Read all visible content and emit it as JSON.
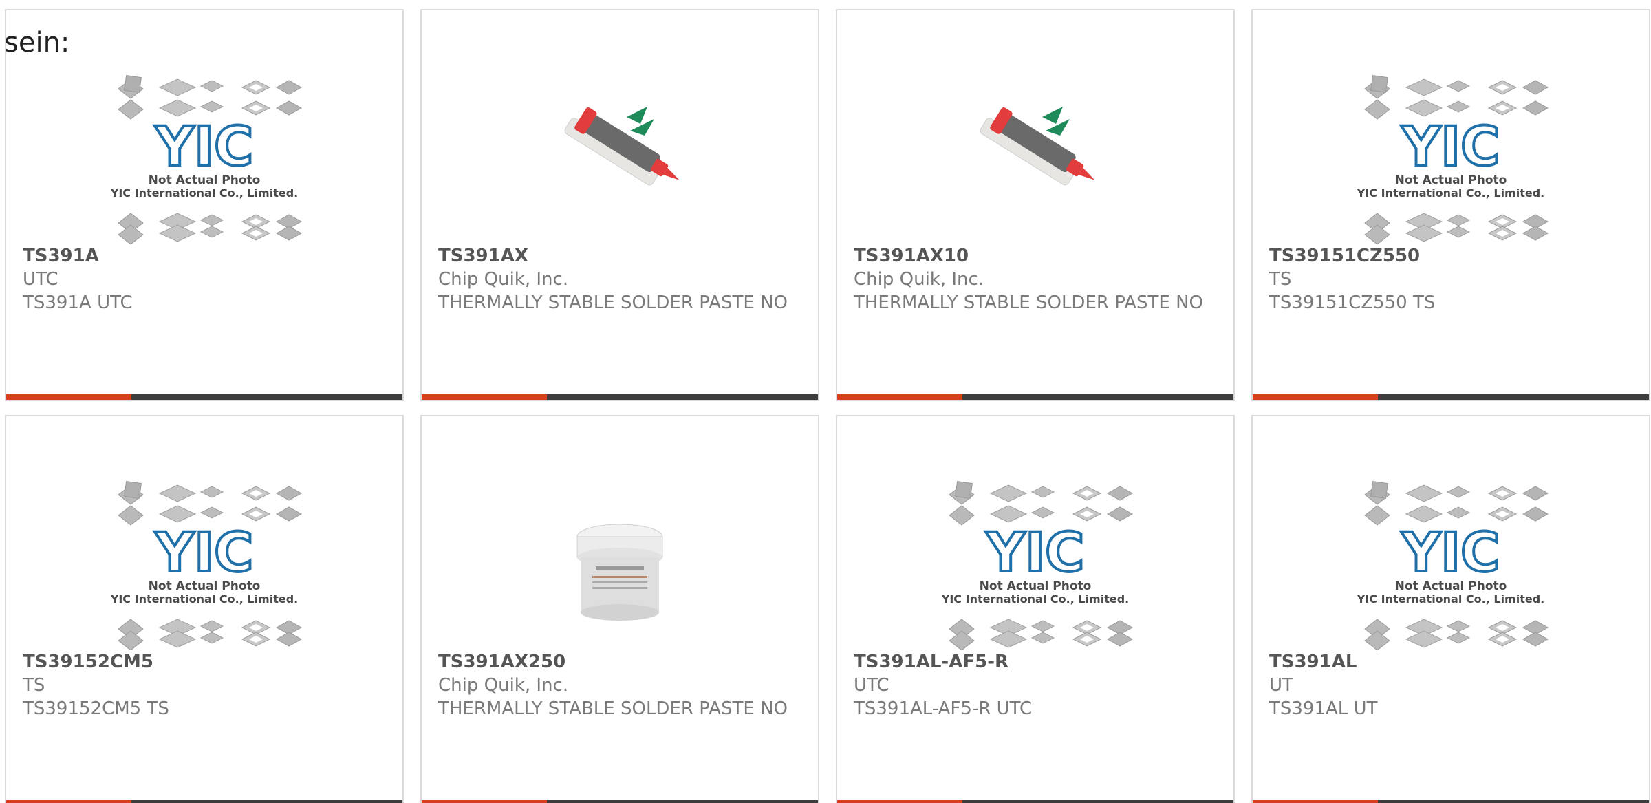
{
  "heading": "sein:",
  "colors": {
    "accent": "#d7401b",
    "bar": "#3d3d3d",
    "border": "#dadada",
    "yic_blue": "#1f6fa8",
    "text": "#7a7a7a"
  },
  "placeholder": {
    "line1": "Not Actual Photo",
    "line2": "YIC International Co., Limited.",
    "logo": "YIC"
  },
  "products": [
    {
      "part": "TS391A",
      "maker": "UTC",
      "desc": "TS391A UTC",
      "image": "yic-placeholder"
    },
    {
      "part": "TS391AX",
      "maker": "Chip Quik, Inc.",
      "desc": "THERMALLY STABLE SOLDER PASTE NO",
      "image": "syringe"
    },
    {
      "part": "TS391AX10",
      "maker": "Chip Quik, Inc.",
      "desc": "THERMALLY STABLE SOLDER PASTE NO",
      "image": "syringe"
    },
    {
      "part": "TS39151CZ550",
      "maker": "TS",
      "desc": "TS39151CZ550 TS",
      "image": "yic-placeholder"
    },
    {
      "part": "TS39152CM5",
      "maker": "TS",
      "desc": "TS39152CM5 TS",
      "image": "yic-placeholder"
    },
    {
      "part": "TS391AX250",
      "maker": "Chip Quik, Inc.",
      "desc": "THERMALLY STABLE SOLDER PASTE NO",
      "image": "jar"
    },
    {
      "part": "TS391AL-AF5-R",
      "maker": "UTC",
      "desc": "TS391AL-AF5-R UTC",
      "image": "yic-placeholder"
    },
    {
      "part": "TS391AL",
      "maker": "UT",
      "desc": "TS391AL UT",
      "image": "yic-placeholder"
    }
  ]
}
